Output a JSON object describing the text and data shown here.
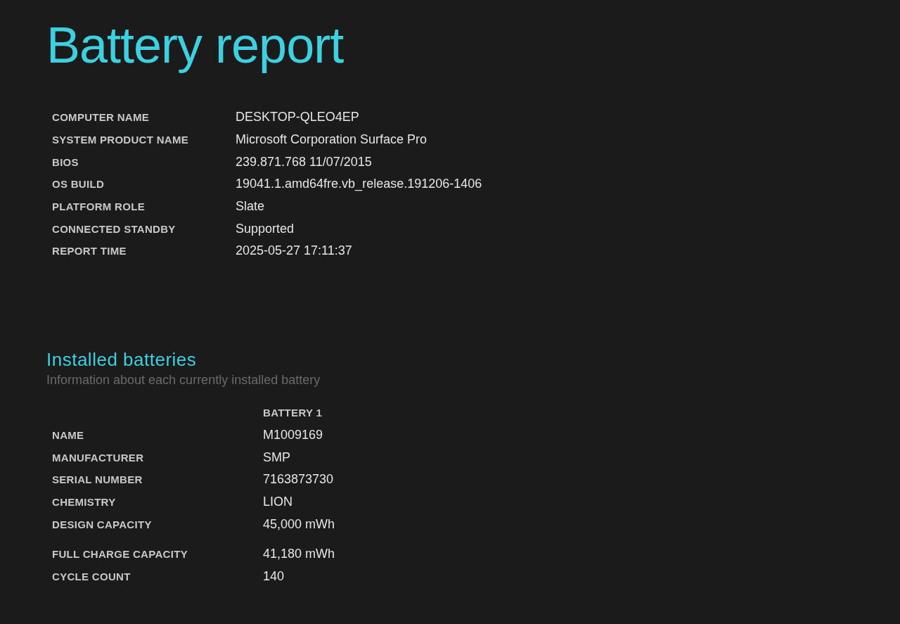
{
  "title": "Battery report",
  "system_info": [
    {
      "label": "COMPUTER NAME",
      "value": "DESKTOP-QLEO4EP"
    },
    {
      "label": "SYSTEM PRODUCT NAME",
      "value": "Microsoft Corporation Surface Pro"
    },
    {
      "label": "BIOS",
      "value": "239.871.768 11/07/2015"
    },
    {
      "label": "OS BUILD",
      "value": "19041.1.amd64fre.vb_release.191206-1406"
    },
    {
      "label": "PLATFORM ROLE",
      "value": "Slate"
    },
    {
      "label": "CONNECTED STANDBY",
      "value": "Supported"
    },
    {
      "label": "REPORT TIME",
      "value": "2025-05-27  17:11:37"
    }
  ],
  "installed_batteries": {
    "heading": "Installed batteries",
    "subtitle": "Information about each currently installed battery",
    "column_header": "BATTERY 1",
    "row_groups": [
      [
        {
          "label": "NAME",
          "value": "M1009169"
        },
        {
          "label": "MANUFACTURER",
          "value": "SMP"
        },
        {
          "label": "SERIAL NUMBER",
          "value": "7163873730"
        },
        {
          "label": "CHEMISTRY",
          "value": "LION"
        },
        {
          "label": "DESIGN CAPACITY",
          "value": "45,000 mWh"
        }
      ],
      [
        {
          "label": "FULL CHARGE CAPACITY",
          "value": "41,180 mWh"
        },
        {
          "label": "CYCLE COUNT",
          "value": "140"
        }
      ]
    ]
  }
}
